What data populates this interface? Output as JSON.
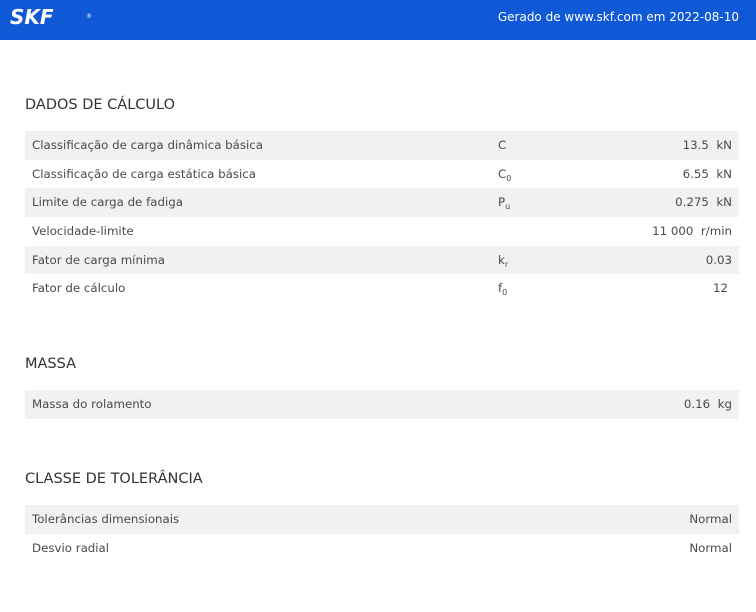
{
  "header": {
    "logo": "SKF",
    "logo_mark": "®",
    "generated": "Gerado de www.skf.com em 2022-08-10",
    "background_color": "#0f58d6"
  },
  "sections": {
    "calc": {
      "title": "DADOS DE CÁLCULO",
      "rows": [
        {
          "label": "Classificação de carga dinâmica básica",
          "sym": "C",
          "sub": "",
          "value": "13.5",
          "unit": "kN"
        },
        {
          "label": "Classificação de carga estática básica",
          "sym": "C",
          "sub": "0",
          "value": "6.55",
          "unit": "kN"
        },
        {
          "label": "Limite de carga de fadiga",
          "sym": "P",
          "sub": "u",
          "value": "0.275",
          "unit": "kN"
        },
        {
          "label": "Velocidade-limite",
          "sym": "",
          "sub": "",
          "value": "11 000",
          "unit": "r/min"
        },
        {
          "label": "Fator de carga mínima",
          "sym": "k",
          "sub": "r",
          "value": "0.03",
          "unit": ""
        },
        {
          "label": "Fator de cálculo",
          "sym": "f",
          "sub": "0",
          "value": "12",
          "unit": ""
        }
      ]
    },
    "mass": {
      "title": "MASSA",
      "rows": [
        {
          "label": "Massa do rolamento",
          "value": "0.16",
          "unit": "kg"
        }
      ]
    },
    "tolerance": {
      "title": "CLASSE DE TOLERÂNCIA",
      "rows": [
        {
          "label": "Tolerâncias dimensionais",
          "value": "Normal"
        },
        {
          "label": "Desvio radial",
          "value": "Normal"
        }
      ]
    }
  }
}
